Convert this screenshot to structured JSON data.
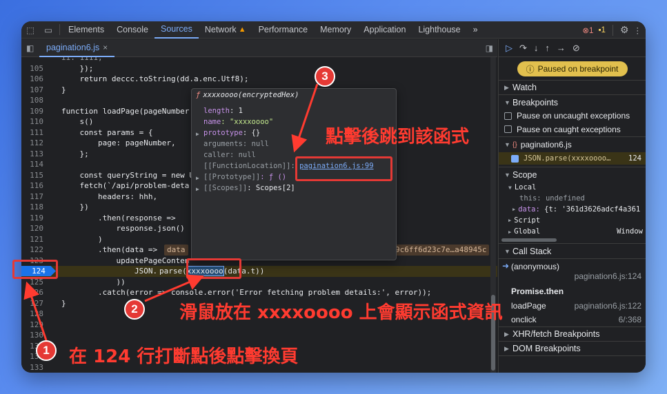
{
  "toolbar": {
    "tabs": [
      "Elements",
      "Console",
      "Sources",
      "Network",
      "Performance",
      "Memory",
      "Application",
      "Lighthouse"
    ],
    "active_tab": "Sources",
    "more": "»",
    "error_count": "1",
    "warning_count": "1"
  },
  "file_tab": {
    "name": "pagination6.js",
    "close": "×"
  },
  "code_lines": [
    {
      "n": "105",
      "t": "    });"
    },
    {
      "n": "106",
      "t": "    return deccc.toString(dd.a.enc.Utf8);"
    },
    {
      "n": "107",
      "t": "}"
    },
    {
      "n": "108",
      "t": ""
    },
    {
      "n": "109",
      "t": "function loadPage(pageNumber"
    },
    {
      "n": "110",
      "t": "    s()"
    },
    {
      "n": "111",
      "t": "    const params = {"
    },
    {
      "n": "112",
      "t": "        page: pageNumber,"
    },
    {
      "n": "113",
      "t": "    };"
    },
    {
      "n": "114",
      "t": ""
    },
    {
      "n": "115",
      "t": "    const queryString = new U"
    },
    {
      "n": "116",
      "t": "    fetch(`/api/problem-deta"
    },
    {
      "n": "117",
      "t": "        headers: hhh,"
    },
    {
      "n": "118",
      "t": "    })"
    },
    {
      "n": "119",
      "t": "        .then(response =>"
    },
    {
      "n": "120",
      "t": "            response.json()"
    },
    {
      "n": "121",
      "t": "        )"
    },
    {
      "n": "122",
      "t": "        .then(data =>"
    },
    {
      "n": "123",
      "t": "            updatePageConten"
    },
    {
      "n": "124",
      "t": "                JSON."
    },
    {
      "n": "125",
      "t": "            ))"
    },
    {
      "n": "126",
      "t": "        .catch(error => console.error('Error fetching problem details:', error));"
    },
    {
      "n": "127",
      "t": "}"
    },
    {
      "n": "128",
      "t": ""
    },
    {
      "n": "129",
      "t": ""
    },
    {
      "n": "130",
      "t": ""
    },
    {
      "n": "131",
      "t": ""
    },
    {
      "n": "132",
      "t": ""
    },
    {
      "n": "133",
      "t": ""
    }
  ],
  "code_extra": {
    "line104_partial": "ii: 1111,",
    "data_badge": "data",
    "data_value": "9c6ff6d23c7e…a48945c",
    "json_parse": "parse(",
    "fn_highlight": "xxxxoooo",
    "call_tail": "(data.t))"
  },
  "popover": {
    "title": "xxxxoooo(encryptedHex)",
    "f_symbol": "ƒ",
    "rows": [
      {
        "k": "length",
        "v": ": 1"
      },
      {
        "k": "name",
        "v": ": \"xxxxoooo\""
      },
      {
        "k": "prototype",
        "v": ": {}"
      },
      {
        "k": "arguments",
        "v": ": null"
      },
      {
        "k": "caller",
        "v": ": null"
      },
      {
        "k": "[[FunctionLocation]]",
        "v": ": "
      },
      {
        "k": "[[Prototype]]",
        "v": ": ƒ ()"
      },
      {
        "k": "[[Scopes]]",
        "v": ": Scopes[2]"
      }
    ],
    "location_link": "pagination6.js:99"
  },
  "debugger": {
    "paused": "Paused on breakpoint",
    "watch": "Watch",
    "breakpoints": "Breakpoints",
    "pause_uncaught": "Pause on uncaught exceptions",
    "pause_caught": "Pause on caught exceptions",
    "bp_file": "pagination6.js",
    "bp_code": "JSON.parse(xxxxoooo…",
    "bp_line": "124",
    "scope": "Scope",
    "local": "Local",
    "this_label": "this:",
    "this_val": "undefined",
    "data_label": "data:",
    "data_val": "{t: '361d3626adcf4a361",
    "script": "Script",
    "global": "Global",
    "global_val": "Window",
    "call_stack": "Call Stack",
    "frames": [
      {
        "name": "(anonymous)",
        "loc": "pagination6.js:124"
      },
      {
        "name": "Promise.then",
        "loc": ""
      },
      {
        "name": "loadPage",
        "loc": "pagination6.js:122"
      },
      {
        "name": "onclick",
        "loc": "6/:368"
      }
    ],
    "xhr": "XHR/fetch Breakpoints",
    "dom": "DOM Breakpoints"
  },
  "annotations": {
    "n1": "1",
    "n2": "2",
    "n3": "3",
    "text1": "在 124 行打斷點後點擊換頁",
    "text2": "滑鼠放在 xxxxoooo 上會顯示函式資訊",
    "text3": "點擊後跳到該函式"
  }
}
